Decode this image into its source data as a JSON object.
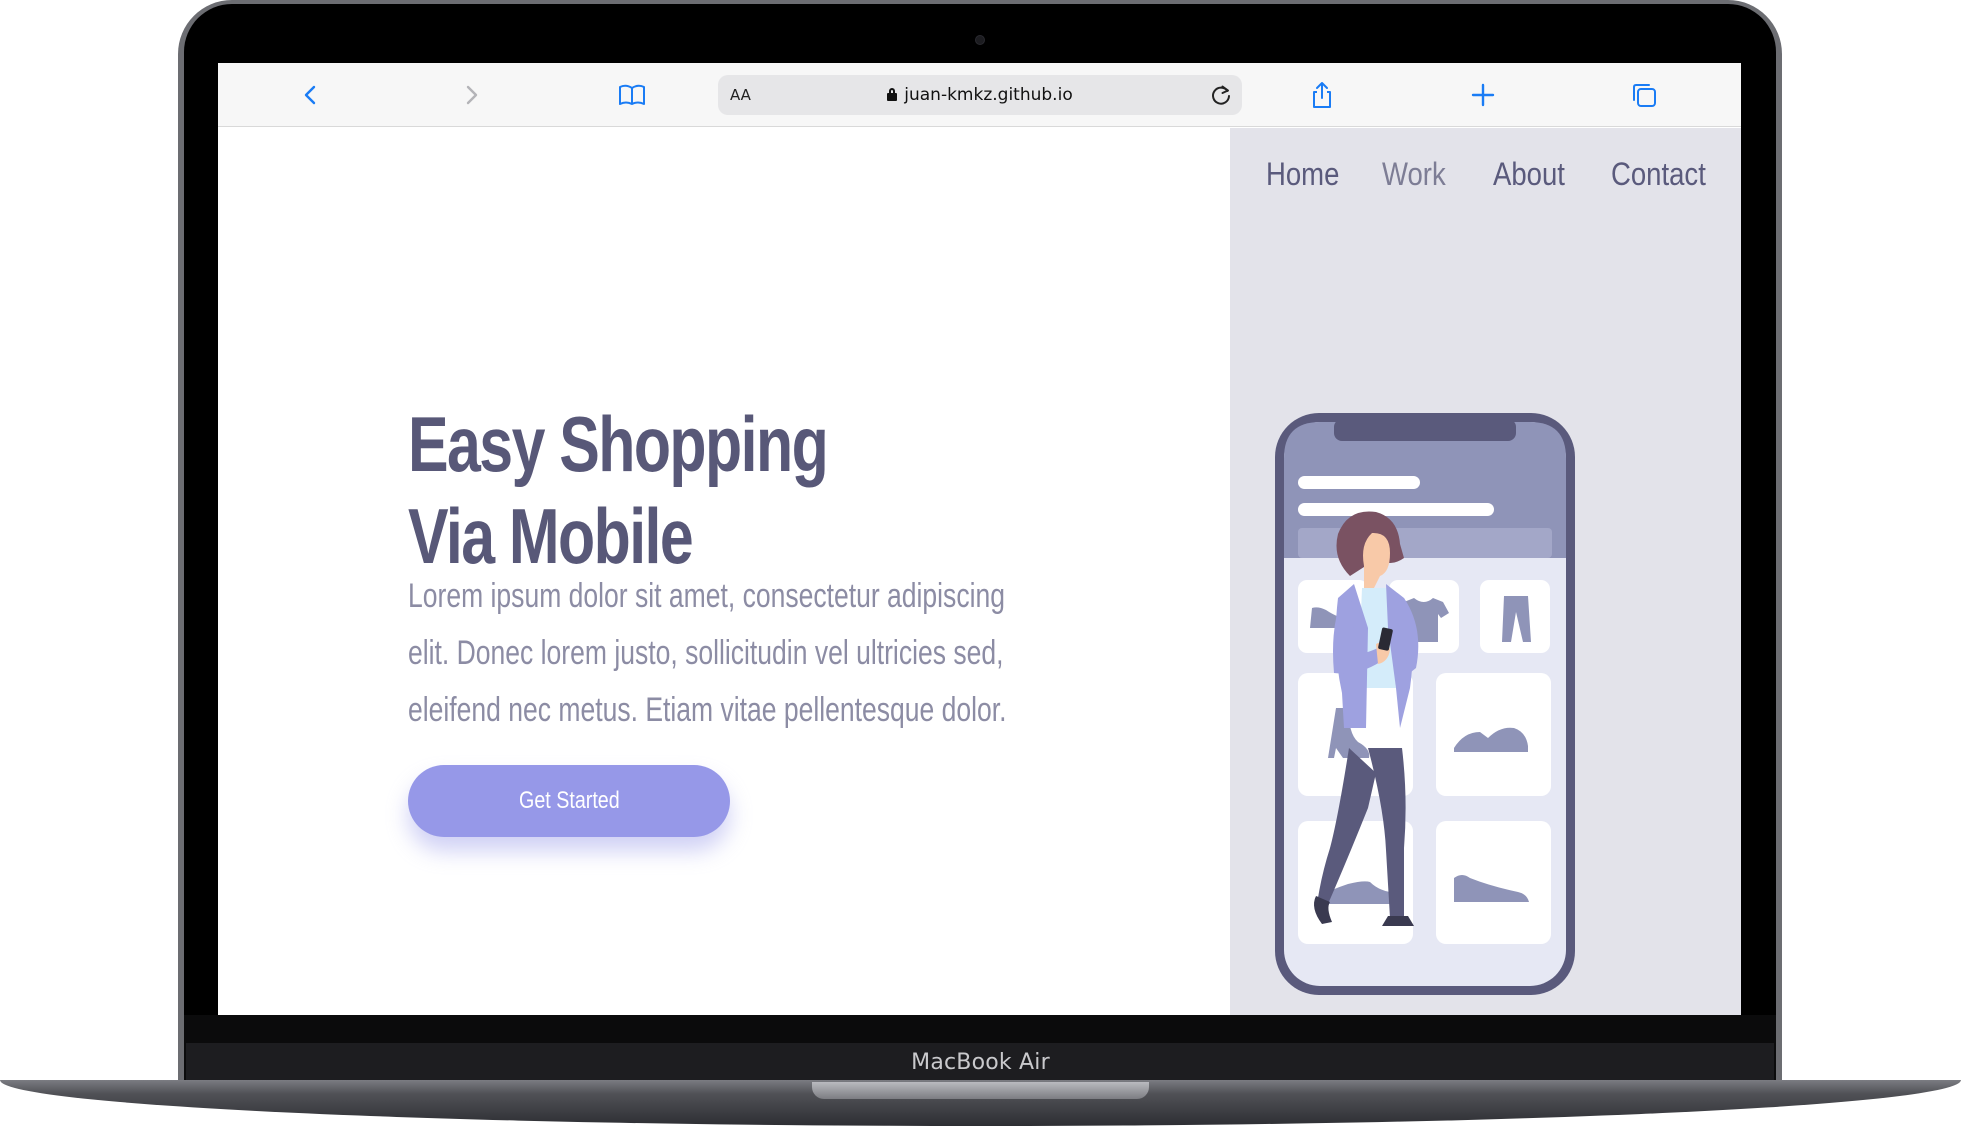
{
  "device": {
    "model_label": "MacBook Air"
  },
  "browser": {
    "aa_label": "AA",
    "url": "juan-kmkz.github.io",
    "icons": [
      "back-icon",
      "forward-icon",
      "bookmarks-icon",
      "lock-icon",
      "reload-icon",
      "share-icon",
      "new-tab-icon",
      "tabs-icon"
    ]
  },
  "nav": {
    "items": [
      "Home",
      "Work",
      "About",
      "Contact"
    ]
  },
  "hero": {
    "title_line1": "Easy Shopping",
    "title_line2": "Via Mobile",
    "text_line1": "Lorem ipsum dolor sit amet, consectetur adipiscing",
    "text_line2": "elit. Donec lorem justo, sollicitudin vel ultricies sed,",
    "text_line3": "eleifend nec metus. Etiam vitae pellentesque dolor.",
    "cta_label": "Get Started"
  },
  "illustration": {
    "subjects": [
      "woman-holding-phone",
      "shopping-app-phone"
    ],
    "product_icons": [
      "shoe-icon",
      "tshirt-icon",
      "pants-icon",
      "boot-icon",
      "sneaker-icon",
      "sneaker-icon",
      "sneaker-icon"
    ]
  },
  "colors": {
    "title": "#585878",
    "body_text": "#8c8ca4",
    "cta_bg": "#9698e8",
    "panel_bg": "#e3e3ea",
    "ios_blue": "#1a7cf5"
  }
}
